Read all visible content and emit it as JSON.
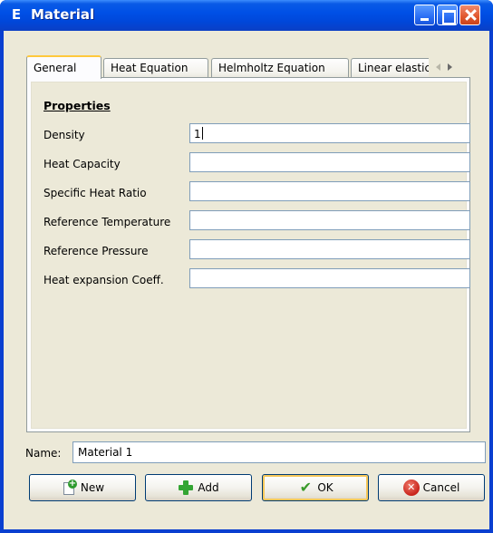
{
  "window": {
    "title": "Material",
    "app_icon_letter": "E"
  },
  "tabs": [
    {
      "label": "General",
      "active": true
    },
    {
      "label": "Heat Equation",
      "active": false
    },
    {
      "label": "Helmholtz Equation",
      "active": false
    },
    {
      "label": "Linear elasticity",
      "active": false
    }
  ],
  "general": {
    "section_title": "Properties",
    "properties": [
      {
        "label": "Density",
        "value": "1"
      },
      {
        "label": "Heat Capacity",
        "value": ""
      },
      {
        "label": "Specific Heat Ratio",
        "value": ""
      },
      {
        "label": "Reference Temperature",
        "value": ""
      },
      {
        "label": "Reference Pressure",
        "value": ""
      },
      {
        "label": "Heat expansion Coeff.",
        "value": ""
      }
    ]
  },
  "name": {
    "label": "Name:",
    "value": "Material 1"
  },
  "buttons": {
    "new": "New",
    "add": "Add",
    "ok": "OK",
    "cancel": "Cancel"
  },
  "colors": {
    "titlebar": "#0050e6",
    "client_bg": "#ece9d8",
    "active_tab_accent": "#ffc83c"
  }
}
